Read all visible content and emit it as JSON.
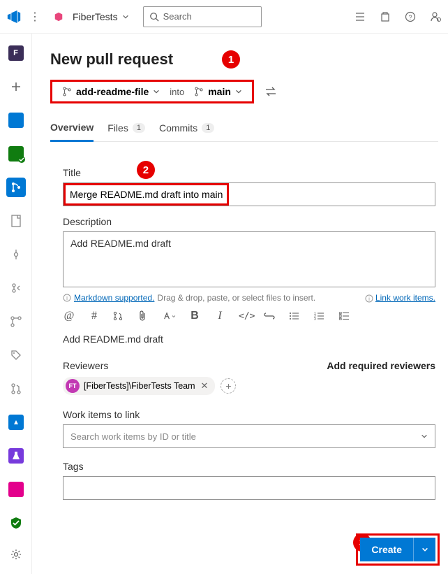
{
  "header": {
    "project": "FiberTests",
    "search_placeholder": "Search"
  },
  "page": {
    "title": "New pull request",
    "source_branch": "add-readme-file",
    "into_label": "into",
    "target_branch": "main"
  },
  "tabs": {
    "overview": "Overview",
    "files": "Files",
    "files_count": "1",
    "commits": "Commits",
    "commits_count": "1"
  },
  "form": {
    "title_label": "Title",
    "title_value": "Merge README.md draft into main",
    "description_label": "Description",
    "description_value": "Add README.md draft",
    "markdown_hint": "Markdown supported.",
    "markdown_rest": "Drag & drop, paste, or select files to insert.",
    "link_work_items": "Link work items.",
    "preview_text": "Add README.md draft",
    "reviewers_label": "Reviewers",
    "add_required": "Add required reviewers",
    "reviewer_chip": "[FiberTests]\\FiberTests Team",
    "reviewer_initials": "FT",
    "work_items_label": "Work items to link",
    "work_items_placeholder": "Search work items by ID or title",
    "tags_label": "Tags"
  },
  "actions": {
    "create": "Create"
  },
  "callouts": {
    "c1": "1",
    "c2": "2",
    "c3": "3"
  }
}
